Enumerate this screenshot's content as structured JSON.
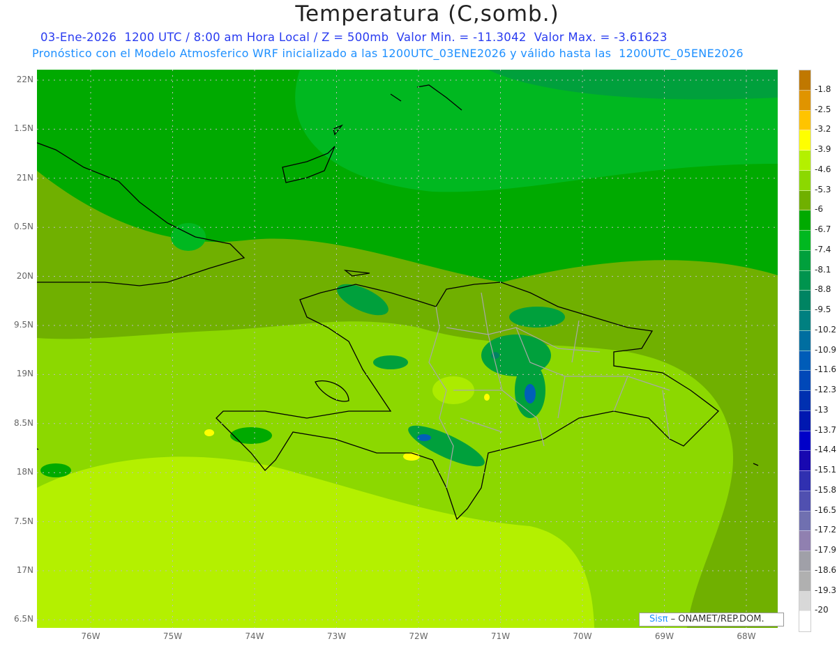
{
  "header": {
    "title": "Temperatura (C,somb.)",
    "subtitle1": "03-Ene-2026  1200 UTC / 8:00 am Hora Local / Z = 500mb  Valor Min. = -11.3042  Valor Max. = -3.61623",
    "subtitle2": "Pronóstico con el Modelo Atmosferico WRF inicializado a las 1200UTC_03ENE2026 y válido hasta las  1200UTC_05ENE2026"
  },
  "axes": {
    "lat_labels": [
      "22N",
      "1.5N",
      "21N",
      "0.5N",
      "20N",
      "9.5N",
      "19N",
      "8.5N",
      "18N",
      "7.5N",
      "17N",
      "6.5N"
    ],
    "lon_labels": [
      "76W",
      "75W",
      "74W",
      "73W",
      "72W",
      "71W",
      "70W",
      "69W",
      "68W"
    ]
  },
  "colorbar": {
    "labels": [
      "-1.8",
      "-2.5",
      "-3.2",
      "-3.9",
      "-4.6",
      "-5.3",
      "-6",
      "-6.7",
      "-7.4",
      "-8.1",
      "-8.8",
      "-9.5",
      "-10.2",
      "-10.9",
      "-11.6",
      "-12.3",
      "-13",
      "-13.7",
      "-14.4",
      "-15.1",
      "-15.8",
      "-16.5",
      "-17.2",
      "-17.9",
      "-18.6",
      "-19.3",
      "-20"
    ],
    "colors": [
      "#c07800",
      "#e09400",
      "#ffc400",
      "#ffff00",
      "#b4f000",
      "#8cd800",
      "#70b000",
      "#00aa00",
      "#00b820",
      "#00a03c",
      "#00944e",
      "#008462",
      "#008080",
      "#006ea0",
      "#005cb8",
      "#0048b8",
      "#0030b0",
      "#0018b0",
      "#0000c8",
      "#1808b0",
      "#3030b0",
      "#5050b0",
      "#7070b0",
      "#9080b0",
      "#a0a0a8",
      "#b0b0b0",
      "#d8d8d8",
      "#ffffff"
    ]
  },
  "credit": {
    "brand": "Sisπ",
    "text": " – ONAMET/REP.DOM."
  }
}
